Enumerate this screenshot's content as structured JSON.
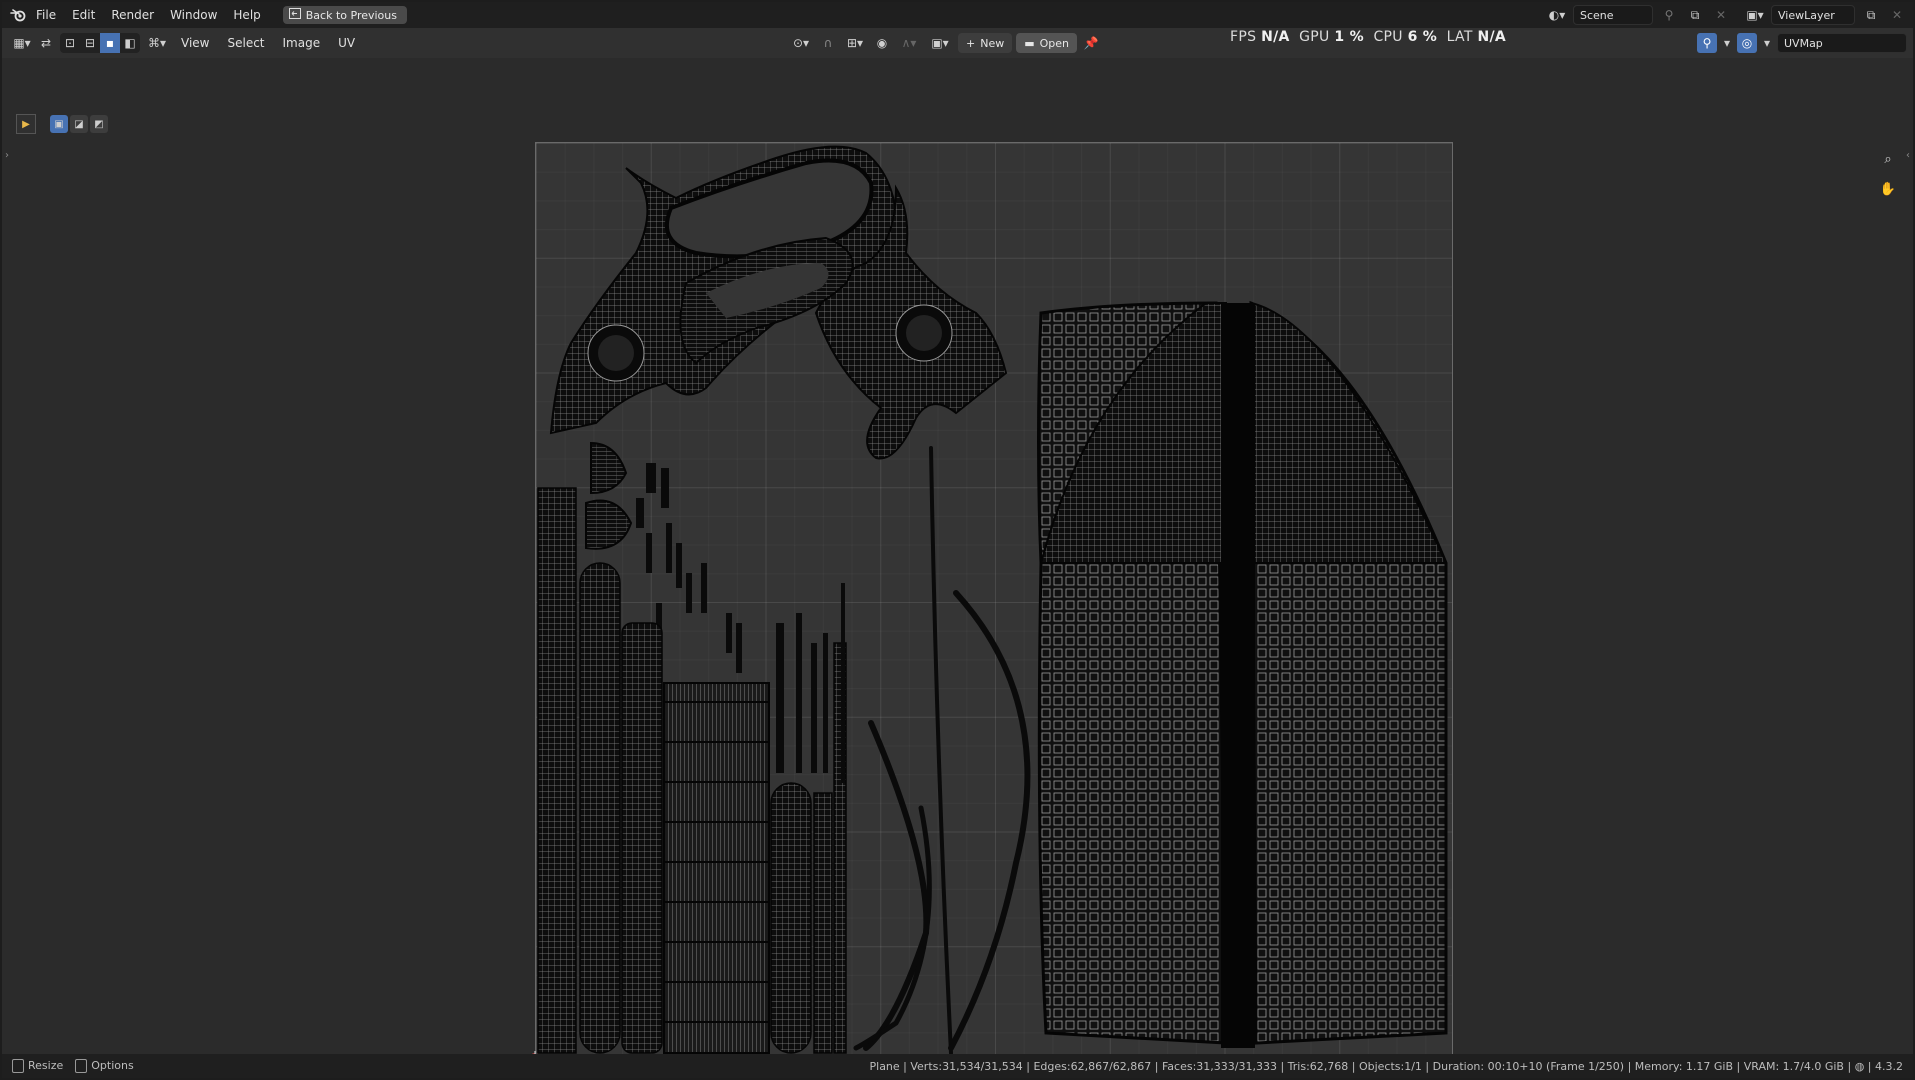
{
  "menu": {
    "items": [
      "File",
      "Edit",
      "Render",
      "Window",
      "Help"
    ],
    "back_button": "Back to Previous"
  },
  "scene": {
    "name": "Scene"
  },
  "view_layer": {
    "name": "ViewLayer"
  },
  "header": {
    "menus": [
      "View",
      "Select",
      "Image",
      "UV"
    ],
    "new_button": "New",
    "open_button": "Open",
    "uv_map": "UVMap"
  },
  "stats": {
    "fps_label": "FPS",
    "fps_value": "N/A",
    "gpu_label": "GPU",
    "gpu_value": "1 %",
    "cpu_label": "CPU",
    "cpu_value": "6 %",
    "lat_label": "LAT",
    "lat_value": "N/A"
  },
  "status": {
    "resize": "Resize",
    "options": "Options",
    "info": "Plane | Verts:31,534/31,534 | Edges:62,867/62,867 | Faces:31,333/31,333 | Tris:62,768 | Objects:1/1 | Duration: 00:10+10 (Frame 1/250) | Memory: 1.17 GiB | VRAM: 1.7/4.0 GiB",
    "version": "4.3.2"
  },
  "icons": {
    "blender": "blender-logo-icon",
    "editor": "image-editor-icon",
    "sync": "uv-sync-icon",
    "zoom": "zoom-icon",
    "pan": "hand-icon"
  }
}
